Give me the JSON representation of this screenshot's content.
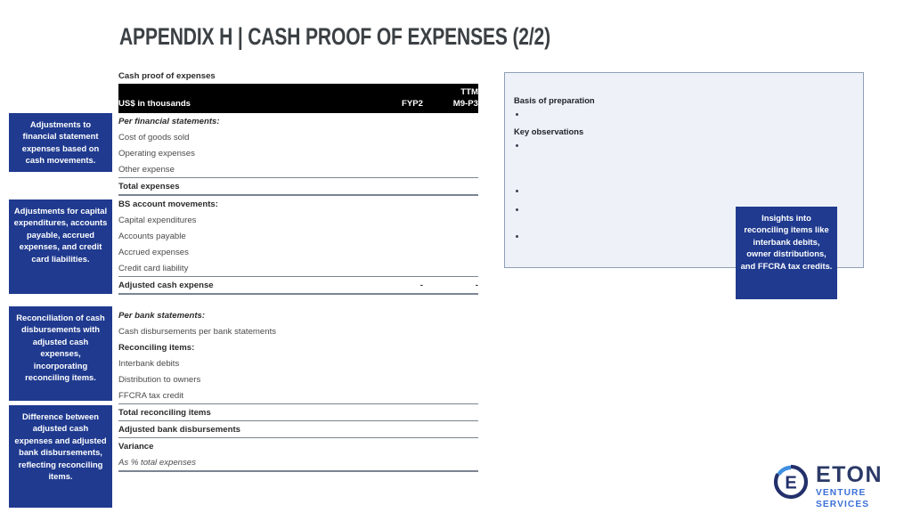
{
  "slide": {
    "title": "APPENDIX H | CASH PROOF OF EXPENSES (2/2)"
  },
  "table": {
    "caption": "Cash proof of expenses",
    "header": {
      "ttm_label": "TTM",
      "units_label": "US$ in thousands",
      "col1": "FYP2",
      "col2": "M9-P3"
    },
    "rows": [
      {
        "label": "Per financial statements:",
        "v1": "",
        "v2": "",
        "style": "sec-head"
      },
      {
        "label": "Cost of goods sold",
        "v1": "",
        "v2": "",
        "style": "item"
      },
      {
        "label": "Operating expenses",
        "v1": "",
        "v2": "",
        "style": "item"
      },
      {
        "label": "Other expense",
        "v1": "",
        "v2": "",
        "style": "item"
      },
      {
        "label": "Total expenses",
        "v1": "",
        "v2": "",
        "style": "total"
      },
      {
        "label": "BS account movements:",
        "v1": "",
        "v2": "",
        "style": "sec-head-u"
      },
      {
        "label": "Capital expenditures",
        "v1": "",
        "v2": "",
        "style": "item"
      },
      {
        "label": "Accounts payable",
        "v1": "",
        "v2": "",
        "style": "item"
      },
      {
        "label": "Accrued expenses",
        "v1": "",
        "v2": "",
        "style": "item"
      },
      {
        "label": "Credit card liability",
        "v1": "",
        "v2": "",
        "style": "item"
      },
      {
        "label": "Adjusted cash expense",
        "v1": "-",
        "v2": "-",
        "style": "total"
      },
      {
        "label": "Per bank statements:",
        "v1": "",
        "v2": "",
        "style": "sec-head"
      },
      {
        "label": "Cash disbursements per bank statements",
        "v1": "",
        "v2": "",
        "style": "item"
      },
      {
        "label": "Reconciling items:",
        "v1": "",
        "v2": "",
        "style": "sec-head-u"
      },
      {
        "label": "Interbank debits",
        "v1": "",
        "v2": "",
        "style": "item"
      },
      {
        "label": "Distribution to owners",
        "v1": "",
        "v2": "",
        "style": "item"
      },
      {
        "label": "FFCRA tax credit",
        "v1": "",
        "v2": "",
        "style": "item"
      },
      {
        "label": "Total reconciling items",
        "v1": "",
        "v2": "",
        "style": "total"
      },
      {
        "label": "Adjusted bank disbursements",
        "v1": "",
        "v2": "",
        "style": "total"
      },
      {
        "label": "Variance",
        "v1": "",
        "v2": "",
        "style": "total"
      },
      {
        "label": "As % total expenses",
        "v1": "",
        "v2": "",
        "style": "ital"
      }
    ]
  },
  "callouts": {
    "left": [
      "Adjustments to financial statement expenses based on cash movements.",
      "Adjustments for capital expenditures, accounts payable, accrued expenses, and credit card liabilities.",
      "Reconciliation of cash disbursements with adjusted cash expenses, incorporating reconciling items.",
      "Difference between adjusted cash expenses and adjusted bank disbursements, reflecting reconciling items."
    ],
    "right": "Insights into reconciling items like interbank debits, owner distributions, and FFCRA tax credits."
  },
  "notes_panel": {
    "basis_heading": "Basis of preparation",
    "key_heading": "Key observations"
  },
  "logo": {
    "word": "ETON",
    "tagline": "VENTURE SERVICES",
    "letter": "E"
  },
  "colors": {
    "callout_blue": "#1f3a8f",
    "panel_fill": "#eef1f7",
    "panel_border": "#8f9fb5",
    "title_gray": "#3b4044",
    "logo_navy": "#2b3a67",
    "logo_blue": "#3a6fd8"
  }
}
